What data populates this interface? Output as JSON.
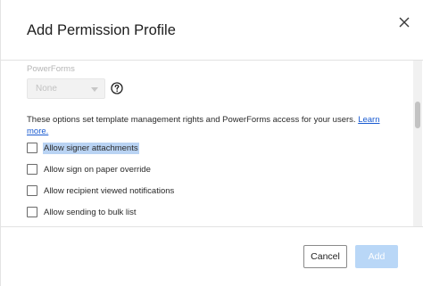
{
  "dialog": {
    "title": "Add Permission Profile",
    "close_icon": "close-icon"
  },
  "powerforms": {
    "label": "PowerForms",
    "select_value": "None",
    "help_icon": "question-circle-icon"
  },
  "description": {
    "text": "These options set template management rights and PowerForms access for your users.",
    "link_text": "Learn more."
  },
  "options": [
    {
      "label": "Allow signer attachments",
      "checked": false,
      "selected_text": true
    },
    {
      "label": "Allow sign on paper override",
      "checked": false
    },
    {
      "label": "Allow recipient viewed notifications",
      "checked": false
    },
    {
      "label": "Allow sending to bulk list",
      "checked": false
    }
  ],
  "footer": {
    "cancel_label": "Cancel",
    "add_label": "Add"
  },
  "colors": {
    "link": "#1a5bd1",
    "add_button_disabled": "#b9d7f7",
    "selection_highlight": "#b9d3f3"
  }
}
